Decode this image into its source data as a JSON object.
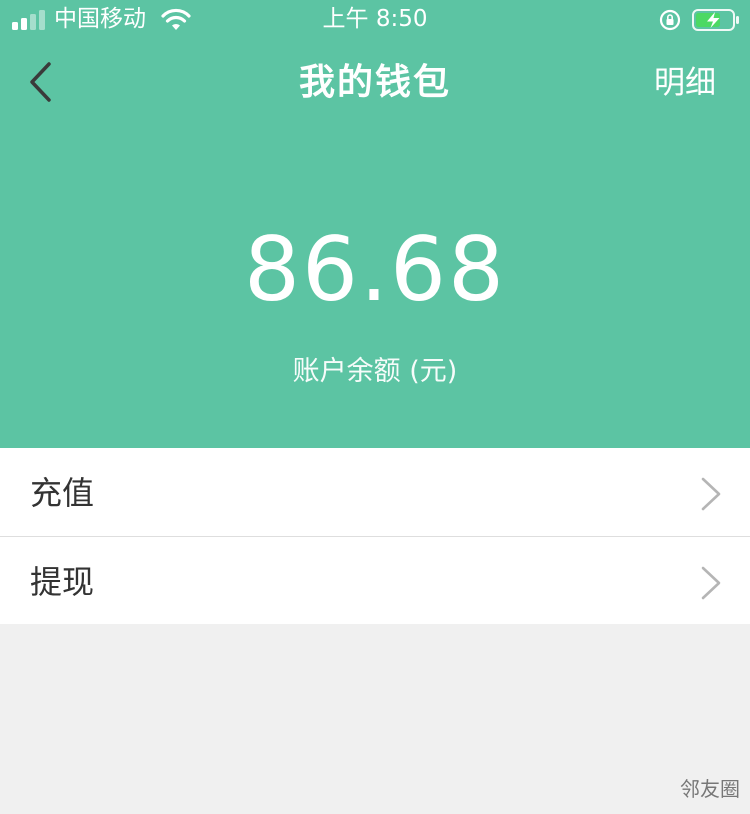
{
  "status_bar": {
    "carrier": "中国移动",
    "time": "上午 8:50"
  },
  "nav": {
    "title": "我的钱包",
    "detail_label": "明细"
  },
  "balance": {
    "amount": "86.68",
    "label": "账户余额 (元)"
  },
  "menu": {
    "items": [
      {
        "label": "充值"
      },
      {
        "label": "提现"
      }
    ]
  },
  "watermark": "邻友圈",
  "colors": {
    "header_bg": "#5cc4a3",
    "page_bg": "#f0f0f0",
    "text_primary": "#333333"
  }
}
